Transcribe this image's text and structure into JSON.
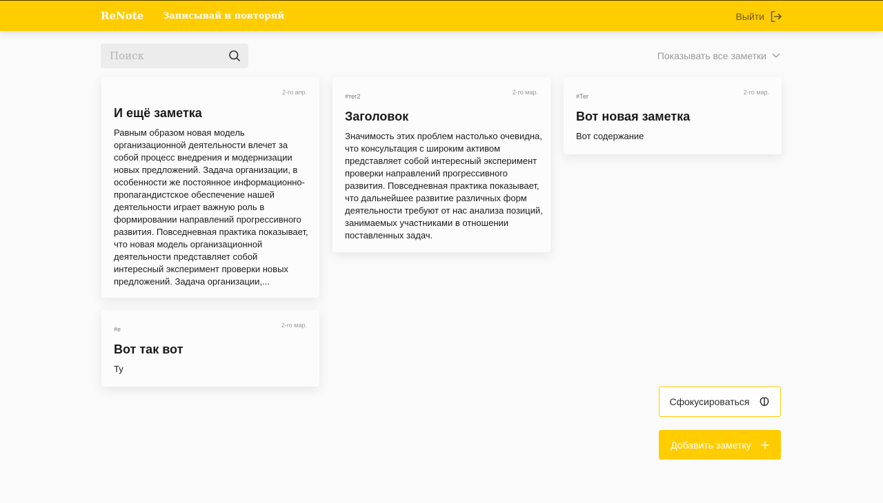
{
  "header": {
    "logo": "ReNote",
    "tagline": "Записывай и повторяй",
    "logout_label": "Выйти"
  },
  "search": {
    "placeholder": "Поиск",
    "value": ""
  },
  "filter": {
    "label": "Показывать все заметки"
  },
  "notes": [
    {
      "tag": "",
      "date": "2-го апр.",
      "title": "И ещё заметка",
      "body": "Равным образом новая модель организационной деятельности влечет за собой процесс внедрения и модернизации новых предложений. Задача организации, в особенности же постоянное информационно-пропагандистское обеспечение нашей деятельности играет важную роль в формировании направлений прогрессивного развития. Повседневная практика показывает, что новая модель организационной деятельности представляет собой интересный эксперимент проверки новых предложений. Задача организации,..."
    },
    {
      "tag": "#тег2",
      "date": "2-го мар.",
      "title": "Заголовок",
      "body": "Значимость этих проблем настолько очевидна, что консультация с широким активом представляет собой интересный эксперимент проверки направлений прогрессивного развития. Повседневная практика показывает, что дальнейшее развитие различных форм деятельности требуют от нас анализа позиций, занимаемых участниками в отношении поставленных задач."
    },
    {
      "tag": "#Тег",
      "date": "2-го мар.",
      "title": "Вот новая заметка",
      "body": "Вот содержание"
    },
    {
      "tag": "#e",
      "date": "2-го мар.",
      "title": "Вот так вот",
      "body": "Ту"
    }
  ],
  "actions": {
    "focus_label": "Сфокусироваться",
    "add_label": "Добавить заметку"
  },
  "colors": {
    "accent": "#ffcc00",
    "background": "#fafafa",
    "card": "#fcfcfc"
  },
  "icons": {
    "logout": "logout-icon",
    "search": "search-icon",
    "filter": "chevron-down-icon",
    "focus": "brain-icon",
    "add": "plus-icon"
  }
}
